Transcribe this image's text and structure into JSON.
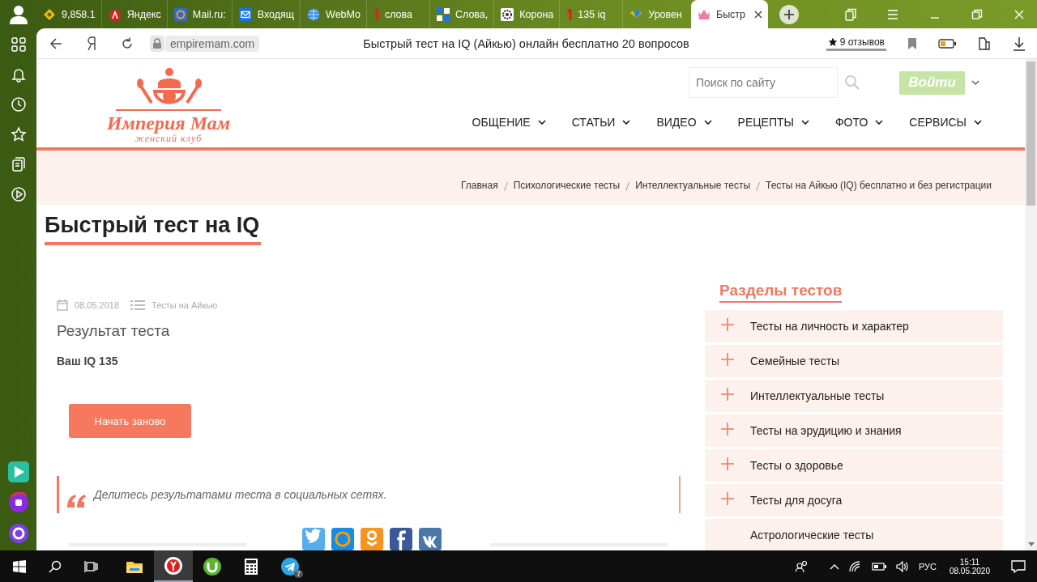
{
  "browser": {
    "tabs": [
      {
        "label": "9,858.1",
        "selected": false
      },
      {
        "label": "Яндекс",
        "selected": false
      },
      {
        "label": "Mail.ru:",
        "selected": false
      },
      {
        "label": "Входящ",
        "selected": false
      },
      {
        "label": "WebMo",
        "selected": false
      },
      {
        "label": "слова",
        "selected": false
      },
      {
        "label": "Слова,",
        "selected": false
      },
      {
        "label": "Корона",
        "selected": false
      },
      {
        "label": "135 iq",
        "selected": false
      },
      {
        "label": "Уровен",
        "selected": false
      },
      {
        "label": "Быстр",
        "selected": true
      }
    ],
    "address_bar": {
      "url": "empiremam.com",
      "page_title": "Быстрый тест на IQ (Айкью) онлайн бесплатно 20 вопросов",
      "reviews": "9 отзывов"
    }
  },
  "site": {
    "logo": {
      "title": "Империя Мам",
      "subtitle": "женский клуб"
    },
    "search": {
      "placeholder": "Поиск по сайту"
    },
    "login": "Войти",
    "nav": [
      "ОБЩЕНИЕ",
      "СТАТЬИ",
      "ВИДЕО",
      "РЕЦЕПТЫ",
      "ФОТО",
      "СЕРВИСЫ"
    ],
    "breadcrumbs": [
      "Главная",
      "Психологические тесты",
      "Интеллектуальные тесты",
      "Тесты на Айкью (IQ) бесплатно и без регистрации"
    ]
  },
  "article": {
    "title": "Быстрый тест на IQ",
    "date": "08.05.2018",
    "category": "Тесты на Айкью",
    "heading": "Результат теста",
    "result": "Ваш IQ 135",
    "restart_button": "Начать заново",
    "share_note": "Делитесь результатами теста в социальных сетях."
  },
  "sections": {
    "title": "Разделы тестов",
    "items": [
      {
        "label": "Тесты на личность и характер",
        "expandable": true
      },
      {
        "label": "Семейные тесты",
        "expandable": true
      },
      {
        "label": "Интеллектуальные тесты",
        "expandable": true
      },
      {
        "label": "Тесты на эрудицию и знания",
        "expandable": true
      },
      {
        "label": "Тесты о здоровье",
        "expandable": true
      },
      {
        "label": "Тесты для досуга",
        "expandable": true
      },
      {
        "label": "Астрологические тесты",
        "expandable": false
      }
    ]
  },
  "taskbar": {
    "apps": [
      {
        "selected": false
      },
      {
        "selected": true
      },
      {
        "selected": false
      },
      {
        "selected": false
      },
      {
        "selected": false,
        "badge": "7"
      }
    ],
    "tray": {
      "language": "РУС",
      "time": "15:11",
      "date": "08.05.2020"
    }
  }
}
